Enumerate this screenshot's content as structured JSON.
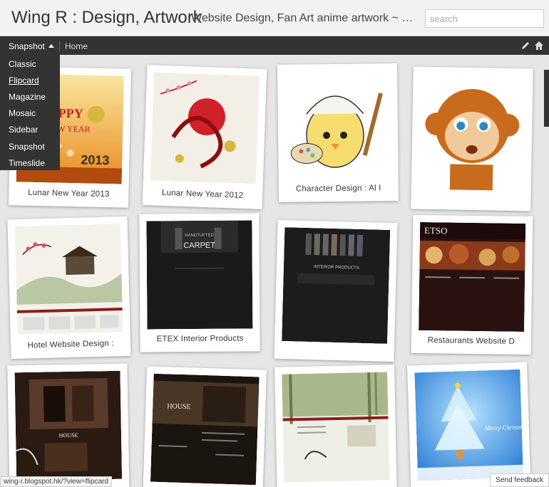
{
  "header": {
    "title": "Wing R : Design, Artwork",
    "description": "Website Design, Fan Art anime artwork ~ blog",
    "search_placeholder": "search"
  },
  "nav": {
    "view_label": "Snapshot",
    "home_label": "Home",
    "icons": [
      "pencil-icon",
      "home-icon"
    ]
  },
  "dropdown": {
    "items": [
      "Classic",
      "Flipcard",
      "Magazine",
      "Mosaic",
      "Sidebar",
      "Snapshot",
      "Timeslide"
    ],
    "selected": "Flipcard"
  },
  "cards": [
    {
      "caption": "Lunar New Year 2013"
    },
    {
      "caption": "Lunar New Year 2012"
    },
    {
      "caption": "Character Design : Al I"
    },
    {
      "caption": ""
    },
    {
      "caption": "Hotel Website Design :"
    },
    {
      "caption": "ETEX Interior Products"
    },
    {
      "caption": ""
    },
    {
      "caption": "Restaurants Website D"
    },
    {
      "caption": ""
    },
    {
      "caption": ""
    },
    {
      "caption": ""
    },
    {
      "caption": ""
    }
  ],
  "thumb_text": {
    "card2": "CARPET",
    "card3": "INTERIOR PRODUCTS",
    "card4": "ETSO",
    "card5": "HOUSE",
    "card6": "HOUSE",
    "card8": "Merry Christmas"
  },
  "status": {
    "url": "wing-r.blogspot.hk/?view=flipcard",
    "feedback": "Send feedback"
  },
  "colors": {
    "navbar": "#333333",
    "background": "#e6e6e6",
    "card": "#ffffff"
  }
}
